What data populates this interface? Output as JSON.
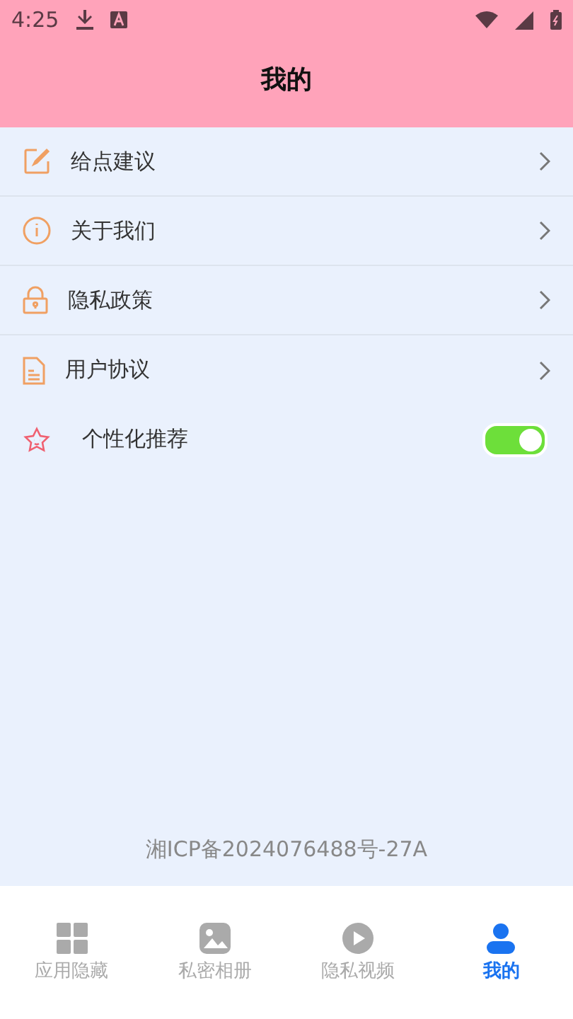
{
  "status_bar": {
    "time": "4:25"
  },
  "header": {
    "title": "我的"
  },
  "menu": [
    {
      "kind": "link",
      "label": "给点建议"
    },
    {
      "kind": "link",
      "label": "关于我们"
    },
    {
      "kind": "link",
      "label": "隐私政策"
    },
    {
      "kind": "link",
      "label": "用户协议"
    },
    {
      "kind": "toggle",
      "label": "个性化推荐",
      "on": true
    }
  ],
  "footer": {
    "text": "湘ICP备2024076488号-27A"
  },
  "tabs": [
    {
      "label": "应用隐藏",
      "selected": false
    },
    {
      "label": "私密相册",
      "selected": false
    },
    {
      "label": "隐私视频",
      "selected": false
    },
    {
      "label": "我的",
      "selected": true
    }
  ]
}
